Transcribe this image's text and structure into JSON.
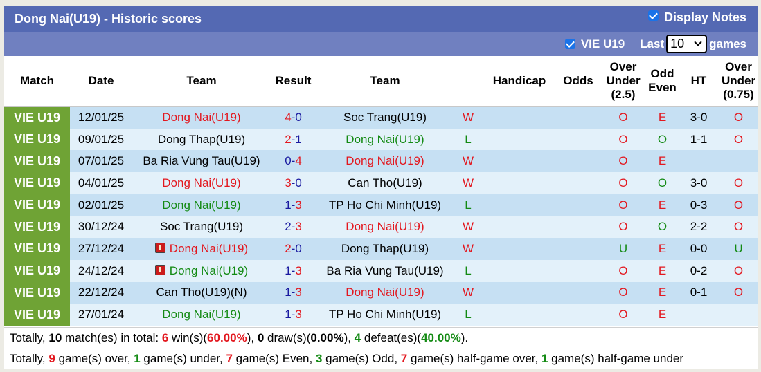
{
  "header": {
    "title": "Dong Nai(U19) - Historic scores",
    "display_notes_label": "Display Notes",
    "display_notes_checked": true
  },
  "filter": {
    "league_label": "VIE U19",
    "league_checked": true,
    "last_label": "Last",
    "games_count": "10",
    "games_label": "games"
  },
  "columns": [
    "Match",
    "Date",
    "Team",
    "Result",
    "Team",
    "",
    "Handicap",
    "Odds",
    "Over Under (2.5)",
    "Odd Even",
    "HT",
    "Over Under (0.75)"
  ],
  "column_lines": {
    "ou25": [
      "Over",
      "Under",
      "(2.5)"
    ],
    "oddeven": [
      "Odd",
      "Even"
    ],
    "ou075": [
      "Over",
      "Under",
      "(0.75)"
    ]
  },
  "colors": {
    "title_bar": "#5469b3",
    "filter_bar": "#7080c0",
    "league_cell": "#6fa335",
    "row_odd": "#c6e0f3",
    "row_even": "#e3f1fa",
    "red": "#e3171e",
    "green": "#138a13",
    "blue": "#1a1aa0"
  },
  "rows": [
    {
      "league": "VIE U19",
      "date": "12/01/25",
      "home": "Dong Nai(U19)",
      "home_color": "red",
      "home_card": false,
      "score_home": "4",
      "score_away": "0",
      "score_home_color": "red",
      "score_away_color": "blue",
      "away": "Soc Trang(U19)",
      "away_color": "black",
      "away_card": false,
      "wl": "W",
      "wl_color": "red",
      "handicap": "",
      "odds": "",
      "ou25": "O",
      "ou25_color": "red",
      "oe": "E",
      "oe_color": "red",
      "ht": "3-0",
      "ou075": "O",
      "ou075_color": "red"
    },
    {
      "league": "VIE U19",
      "date": "09/01/25",
      "home": "Dong Thap(U19)",
      "home_color": "black",
      "home_card": false,
      "score_home": "2",
      "score_away": "1",
      "score_home_color": "red",
      "score_away_color": "blue",
      "away": "Dong Nai(U19)",
      "away_color": "green",
      "away_card": false,
      "wl": "L",
      "wl_color": "green",
      "handicap": "",
      "odds": "",
      "ou25": "O",
      "ou25_color": "red",
      "oe": "O",
      "oe_color": "green",
      "ht": "1-1",
      "ou075": "O",
      "ou075_color": "red"
    },
    {
      "league": "VIE U19",
      "date": "07/01/25",
      "home": "Ba Ria Vung Tau(U19)",
      "home_color": "black",
      "home_card": false,
      "score_home": "0",
      "score_away": "4",
      "score_home_color": "blue",
      "score_away_color": "red",
      "away": "Dong Nai(U19)",
      "away_color": "red",
      "away_card": false,
      "wl": "W",
      "wl_color": "red",
      "handicap": "",
      "odds": "",
      "ou25": "O",
      "ou25_color": "red",
      "oe": "E",
      "oe_color": "red",
      "ht": "",
      "ou075": "",
      "ou075_color": "red"
    },
    {
      "league": "VIE U19",
      "date": "04/01/25",
      "home": "Dong Nai(U19)",
      "home_color": "red",
      "home_card": false,
      "score_home": "3",
      "score_away": "0",
      "score_home_color": "red",
      "score_away_color": "blue",
      "away": "Can Tho(U19)",
      "away_color": "black",
      "away_card": false,
      "wl": "W",
      "wl_color": "red",
      "handicap": "",
      "odds": "",
      "ou25": "O",
      "ou25_color": "red",
      "oe": "O",
      "oe_color": "green",
      "ht": "3-0",
      "ou075": "O",
      "ou075_color": "red"
    },
    {
      "league": "VIE U19",
      "date": "02/01/25",
      "home": "Dong Nai(U19)",
      "home_color": "green",
      "home_card": false,
      "score_home": "1",
      "score_away": "3",
      "score_home_color": "blue",
      "score_away_color": "red",
      "away": "TP Ho Chi Minh(U19)",
      "away_color": "black",
      "away_card": false,
      "wl": "L",
      "wl_color": "green",
      "handicap": "",
      "odds": "",
      "ou25": "O",
      "ou25_color": "red",
      "oe": "E",
      "oe_color": "red",
      "ht": "0-3",
      "ou075": "O",
      "ou075_color": "red"
    },
    {
      "league": "VIE U19",
      "date": "30/12/24",
      "home": "Soc Trang(U19)",
      "home_color": "black",
      "home_card": false,
      "score_home": "2",
      "score_away": "3",
      "score_home_color": "blue",
      "score_away_color": "red",
      "away": "Dong Nai(U19)",
      "away_color": "red",
      "away_card": false,
      "wl": "W",
      "wl_color": "red",
      "handicap": "",
      "odds": "",
      "ou25": "O",
      "ou25_color": "red",
      "oe": "O",
      "oe_color": "green",
      "ht": "2-2",
      "ou075": "O",
      "ou075_color": "red"
    },
    {
      "league": "VIE U19",
      "date": "27/12/24",
      "home": "Dong Nai(U19)",
      "home_color": "red",
      "home_card": true,
      "score_home": "2",
      "score_away": "0",
      "score_home_color": "red",
      "score_away_color": "blue",
      "away": "Dong Thap(U19)",
      "away_color": "black",
      "away_card": false,
      "wl": "W",
      "wl_color": "red",
      "handicap": "",
      "odds": "",
      "ou25": "U",
      "ou25_color": "green",
      "oe": "E",
      "oe_color": "red",
      "ht": "0-0",
      "ou075": "U",
      "ou075_color": "green"
    },
    {
      "league": "VIE U19",
      "date": "24/12/24",
      "home": "Dong Nai(U19)",
      "home_color": "green",
      "home_card": true,
      "score_home": "1",
      "score_away": "3",
      "score_home_color": "blue",
      "score_away_color": "red",
      "away": "Ba Ria Vung Tau(U19)",
      "away_color": "black",
      "away_card": false,
      "wl": "L",
      "wl_color": "green",
      "handicap": "",
      "odds": "",
      "ou25": "O",
      "ou25_color": "red",
      "oe": "E",
      "oe_color": "red",
      "ht": "0-2",
      "ou075": "O",
      "ou075_color": "red"
    },
    {
      "league": "VIE U19",
      "date": "22/12/24",
      "home": "Can Tho(U19)(N)",
      "home_color": "black",
      "home_card": false,
      "score_home": "1",
      "score_away": "3",
      "score_home_color": "blue",
      "score_away_color": "red",
      "away": "Dong Nai(U19)",
      "away_color": "red",
      "away_card": false,
      "wl": "W",
      "wl_color": "red",
      "handicap": "",
      "odds": "",
      "ou25": "O",
      "ou25_color": "red",
      "oe": "E",
      "oe_color": "red",
      "ht": "0-1",
      "ou075": "O",
      "ou075_color": "red"
    },
    {
      "league": "VIE U19",
      "date": "27/01/24",
      "home": "Dong Nai(U19)",
      "home_color": "green",
      "home_card": false,
      "score_home": "1",
      "score_away": "3",
      "score_home_color": "blue",
      "score_away_color": "red",
      "away": "TP Ho Chi Minh(U19)",
      "away_color": "black",
      "away_card": false,
      "wl": "L",
      "wl_color": "green",
      "handicap": "",
      "odds": "",
      "ou25": "O",
      "ou25_color": "red",
      "oe": "E",
      "oe_color": "red",
      "ht": "",
      "ou075": "",
      "ou075_color": "red"
    }
  ],
  "summary": {
    "line1": [
      {
        "t": "Totally, ",
        "c": ""
      },
      {
        "t": "10",
        "c": "b"
      },
      {
        "t": " match(es) in total: ",
        "c": ""
      },
      {
        "t": "6",
        "c": "red b"
      },
      {
        "t": " win(s)(",
        "c": ""
      },
      {
        "t": "60.00%",
        "c": "red b"
      },
      {
        "t": "), ",
        "c": ""
      },
      {
        "t": "0",
        "c": "blue b"
      },
      {
        "t": " draw(s)(",
        "c": ""
      },
      {
        "t": "0.00%",
        "c": "blue b"
      },
      {
        "t": "), ",
        "c": ""
      },
      {
        "t": "4",
        "c": "green b"
      },
      {
        "t": " defeat(es)(",
        "c": ""
      },
      {
        "t": "40.00%",
        "c": "green b"
      },
      {
        "t": ").",
        "c": ""
      }
    ],
    "line2": [
      {
        "t": "Totally, ",
        "c": ""
      },
      {
        "t": "9",
        "c": "red b"
      },
      {
        "t": " game(s) over, ",
        "c": ""
      },
      {
        "t": "1",
        "c": "green b"
      },
      {
        "t": " game(s) under, ",
        "c": ""
      },
      {
        "t": "7",
        "c": "red b"
      },
      {
        "t": " game(s) Even, ",
        "c": ""
      },
      {
        "t": "3",
        "c": "green b"
      },
      {
        "t": " game(s) Odd, ",
        "c": ""
      },
      {
        "t": "7",
        "c": "red b"
      },
      {
        "t": " game(s) half-game over, ",
        "c": ""
      },
      {
        "t": "1",
        "c": "green b"
      },
      {
        "t": " game(s) half-game under",
        "c": ""
      }
    ]
  }
}
